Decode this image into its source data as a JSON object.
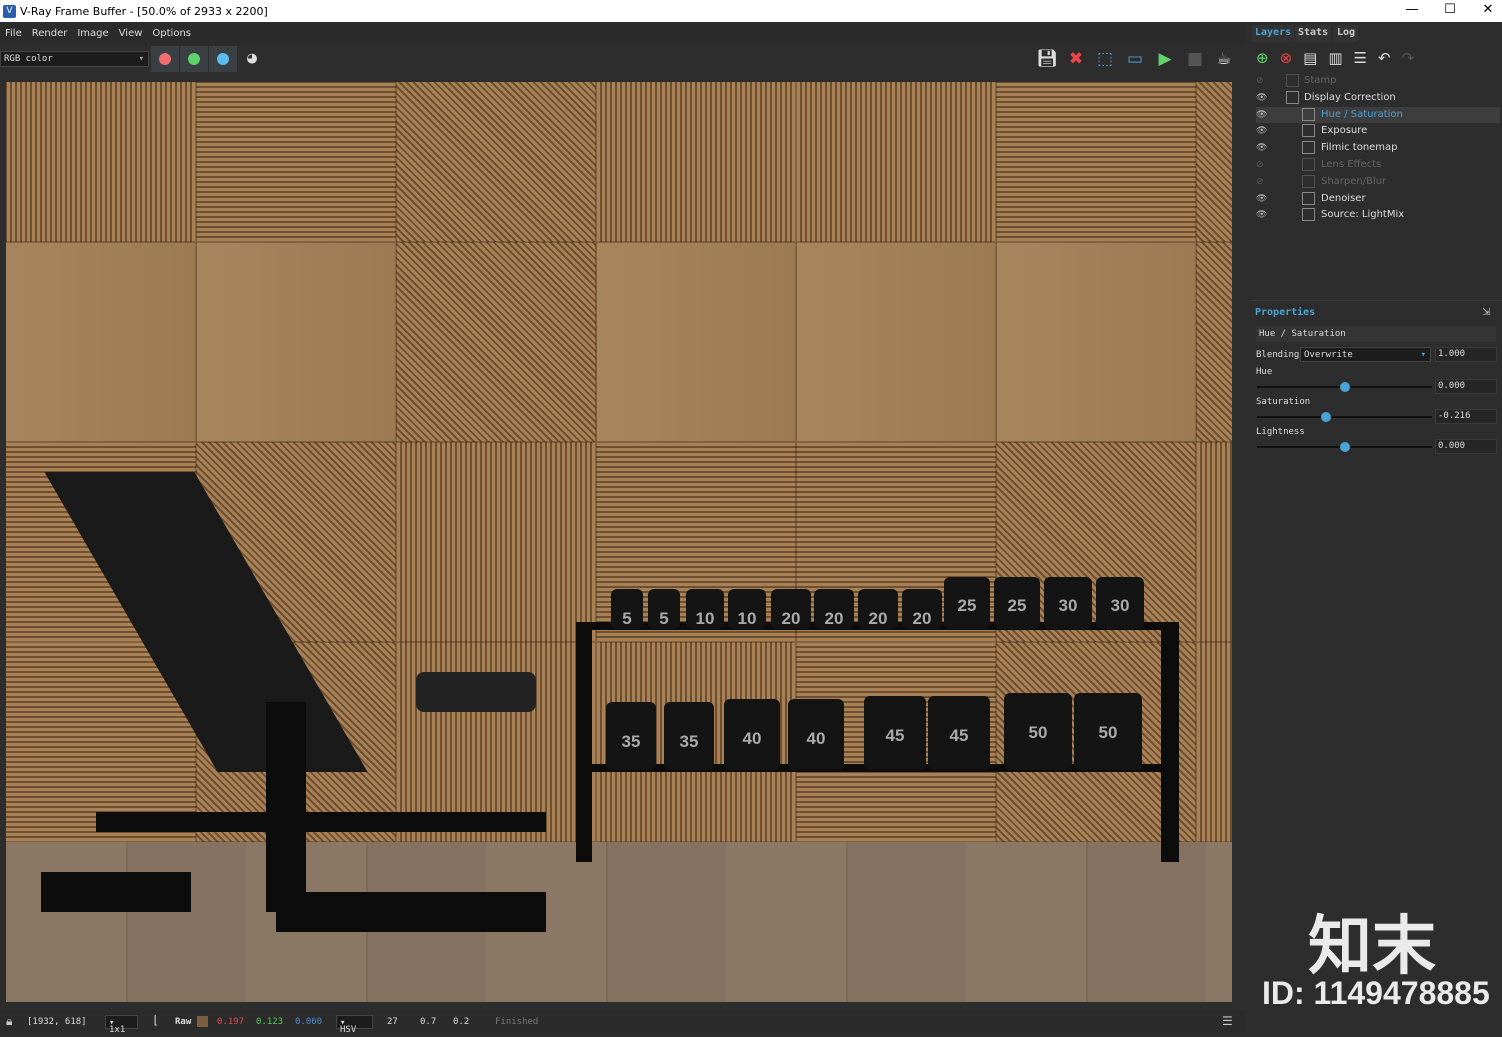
{
  "window": {
    "title": "V-Ray Frame Buffer - [50.0% of 2933 x 2200]",
    "minimize": "—",
    "maximize": "☐",
    "close": "✕"
  },
  "menu": [
    "File",
    "Render",
    "Image",
    "View",
    "Options"
  ],
  "toolbar": {
    "channel": "RGB color",
    "channel_colors": {
      "red": "#f26d6d",
      "green": "#5fd36a",
      "blue": "#5bbcf0"
    },
    "icons": [
      "save-image-icon",
      "clear-image-icon",
      "region-render-icon",
      "frame-icon",
      "start-render-icon",
      "stop-render-icon",
      "render-last-icon"
    ]
  },
  "render": {
    "top_row_labels": [
      "5",
      "5",
      "10",
      "10",
      "20",
      "20",
      "20",
      "20",
      "25",
      "25",
      "30",
      "30"
    ],
    "bottom_row_labels": [
      "35",
      "35",
      "40",
      "40",
      "45",
      "45",
      "50",
      "50"
    ]
  },
  "statusbar": {
    "coords": "[1932, 618]",
    "zoom": "1x1",
    "mode": "Raw",
    "swatch": "#7a5e3f",
    "r": "0.197",
    "g": "0.123",
    "b": "0.060",
    "colorspace": "HSV",
    "h": "27",
    "s": "0.7",
    "v": "0.2",
    "status": "Finished"
  },
  "panel": {
    "tabs": [
      "Layers",
      "Stats",
      "Log"
    ],
    "layers": [
      {
        "name": "Stamp",
        "visible": false,
        "indent": 0
      },
      {
        "name": "Display Correction",
        "visible": true,
        "indent": 0
      },
      {
        "name": "Hue / Saturation",
        "visible": true,
        "indent": 1,
        "selected": true
      },
      {
        "name": "Exposure",
        "visible": true,
        "indent": 1
      },
      {
        "name": "Filmic tonemap",
        "visible": true,
        "indent": 1
      },
      {
        "name": "Lens Effects",
        "visible": false,
        "indent": 1
      },
      {
        "name": "Sharpen/Blur",
        "visible": false,
        "indent": 1
      },
      {
        "name": "Denoiser",
        "visible": true,
        "indent": 1
      },
      {
        "name": "Source: LightMix",
        "visible": true,
        "indent": 1
      }
    ],
    "properties_title": "Properties",
    "layer_name": "Hue / Saturation",
    "blending_label": "Blending",
    "blending_mode": "Overwrite",
    "blending_amount": "1.000",
    "hue_label": "Hue",
    "hue_value": "0.000",
    "hue_fraction": 0.5,
    "saturation_label": "Saturation",
    "saturation_value": "-0.216",
    "saturation_fraction": 0.392,
    "lightness_label": "Lightness",
    "lightness_value": "0.000",
    "lightness_fraction": 0.5
  },
  "watermark": {
    "brand": "知末",
    "id": "ID: 1149478885"
  }
}
